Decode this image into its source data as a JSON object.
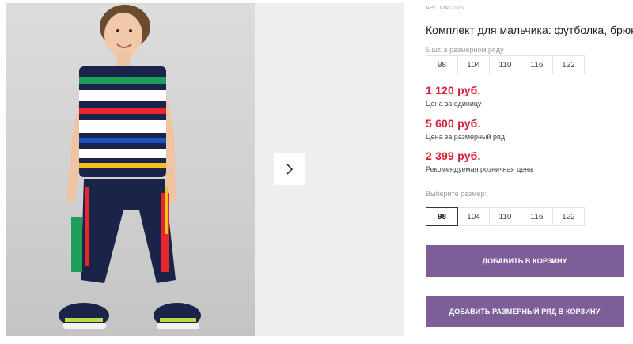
{
  "gallery": {
    "next_icon": "chevron-right-icon"
  },
  "product": {
    "article": "АРТ. 12412126",
    "title": "Комплект для мальчика: футболка, брюки",
    "pack_label": "5 шт. в размерном ряду",
    "pack_sizes": [
      "98",
      "104",
      "110",
      "116",
      "122"
    ],
    "prices": [
      {
        "value": "1 120 руб.",
        "note": "Цена за единицу"
      },
      {
        "value": "5 600 руб.",
        "note": "Цена за размерный ряд"
      },
      {
        "value": "2 399 руб.",
        "note": "Рекомендуемая розничная цена"
      }
    ],
    "choose_label": "Выберите размер:",
    "select_sizes": [
      "98",
      "104",
      "110",
      "116",
      "122"
    ],
    "selected_size": "98"
  },
  "actions": {
    "add_to_cart": "ДОБАВИТЬ В КОРЗИНУ",
    "add_pack_to_cart": "ДОБАВИТЬ РАЗМЕРНЫЙ РЯД В КОРЗИНУ"
  },
  "colors": {
    "price": "#d81f35",
    "button": "#7c5f99"
  }
}
